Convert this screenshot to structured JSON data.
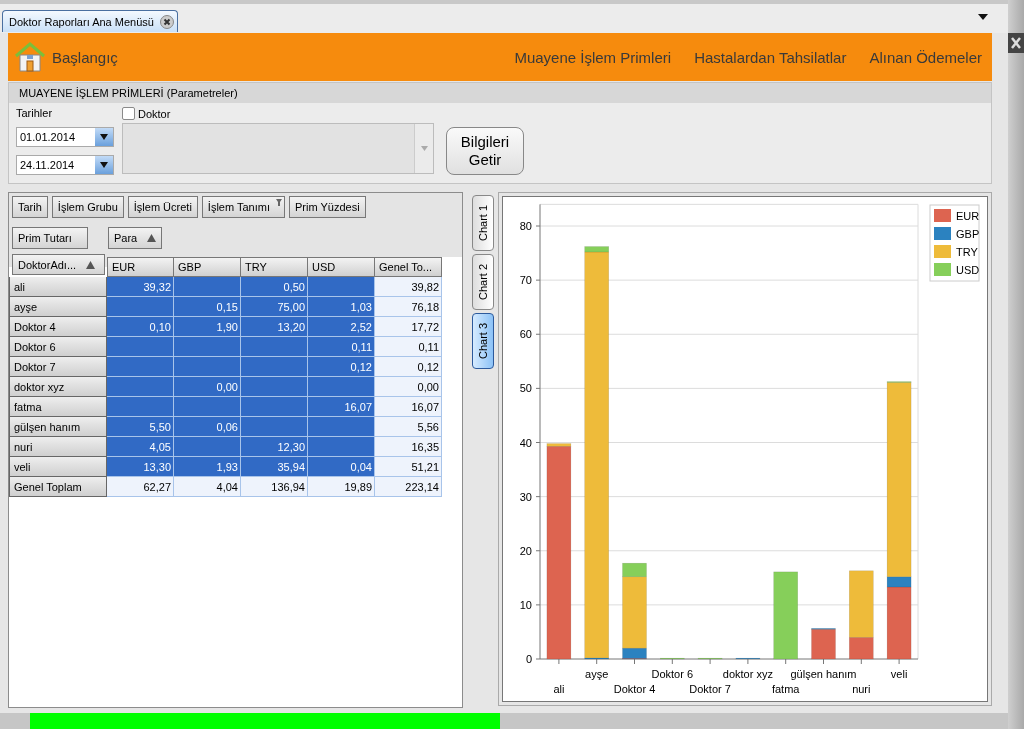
{
  "tab": {
    "title": "Doktor Raporları Ana Menüsü"
  },
  "nav": {
    "home": "Başlangıç",
    "links": [
      "Muayene İşlem Primleri",
      "Hastalardan Tahsilatlar",
      "Alınan Ödemeler"
    ]
  },
  "params": {
    "title": "MUAYENE İŞLEM PRİMLERİ (Parametreler)",
    "dates_label": "Tarihler",
    "date_from": "01.01.2014",
    "date_to": "24.11.2014",
    "doctor": {
      "label": "Doktor",
      "checked": false
    },
    "button": "Bilgileri Getir"
  },
  "pivot": {
    "filter_fields": [
      {
        "label": "Tarih",
        "filtered": false
      },
      {
        "label": "İşlem Grubu",
        "filtered": false
      },
      {
        "label": "İşlem Ücreti",
        "filtered": false
      },
      {
        "label": "İşlem Tanımı",
        "filtered": true
      },
      {
        "label": "Prim Yüzdesi",
        "filtered": false
      }
    ],
    "data_field": "Prim Tutarı",
    "column_field": {
      "label": "Para",
      "sort_ascending": true
    },
    "row_field": {
      "label": "DoktorAdı...",
      "sort_ascending": true
    },
    "columns": [
      "EUR",
      "GBP",
      "TRY",
      "USD",
      "Genel To..."
    ],
    "rows": [
      {
        "name": "ali",
        "cells": [
          "39,32",
          null,
          "0,50",
          null,
          "39,82"
        ]
      },
      {
        "name": "ayşe",
        "cells": [
          null,
          "0,15",
          "75,00",
          "1,03",
          "76,18"
        ]
      },
      {
        "name": "Doktor 4",
        "cells": [
          "0,10",
          "1,90",
          "13,20",
          "2,52",
          "17,72"
        ]
      },
      {
        "name": "Doktor 6",
        "cells": [
          null,
          null,
          null,
          "0,11",
          "0,11"
        ]
      },
      {
        "name": "Doktor 7",
        "cells": [
          null,
          null,
          null,
          "0,12",
          "0,12"
        ]
      },
      {
        "name": "doktor xyz",
        "cells": [
          null,
          "0,00",
          null,
          null,
          "0,00"
        ]
      },
      {
        "name": "fatma",
        "cells": [
          null,
          null,
          null,
          "16,07",
          "16,07"
        ]
      },
      {
        "name": "gülşen hanım",
        "cells": [
          "5,50",
          "0,06",
          null,
          null,
          "5,56"
        ]
      },
      {
        "name": "nuri",
        "cells": [
          "4,05",
          null,
          "12,30",
          null,
          "16,35"
        ]
      },
      {
        "name": "veli",
        "cells": [
          "13,30",
          "1,93",
          "35,94",
          "0,04",
          "51,21"
        ]
      }
    ],
    "total": {
      "name": "Genel Toplam",
      "cells": [
        "62,27",
        "4,04",
        "136,94",
        "19,89",
        "223,14"
      ]
    }
  },
  "chart_tabs": [
    {
      "label": "Chart 1",
      "selected": false
    },
    {
      "label": "Chart 2",
      "selected": false
    },
    {
      "label": "Chart 3",
      "selected": true
    }
  ],
  "chart": {
    "chart_data": {
      "type": "bar",
      "stacked": true,
      "orientation": "vertical",
      "categories": [
        "ali",
        "ayşe",
        "Doktor 4",
        "Doktor 6",
        "Doktor 7",
        "doktor xyz",
        "fatma",
        "gülşen hanım",
        "nuri",
        "veli"
      ],
      "series": [
        {
          "name": "EUR",
          "color": "#dd6450",
          "values": [
            39.3,
            null,
            0.1,
            null,
            null,
            null,
            null,
            5.5,
            4.0,
            13.3
          ]
        },
        {
          "name": "GBP",
          "color": "#2b82c0",
          "values": [
            null,
            0.2,
            1.9,
            null,
            null,
            0.0,
            null,
            0.1,
            null,
            1.9
          ]
        },
        {
          "name": "TRY",
          "color": "#eebb3a",
          "values": [
            0.5,
            75.0,
            13.2,
            null,
            null,
            null,
            null,
            null,
            12.3,
            35.9
          ]
        },
        {
          "name": "USD",
          "color": "#86cf5a",
          "values": [
            null,
            1.0,
            2.5,
            0.1,
            0.1,
            null,
            16.1,
            null,
            null,
            0.0
          ]
        }
      ],
      "ylim": [
        0,
        84
      ],
      "yticks": [
        0,
        10,
        20,
        30,
        40,
        50,
        60,
        70,
        80
      ],
      "grid": true,
      "legend": true
    }
  }
}
